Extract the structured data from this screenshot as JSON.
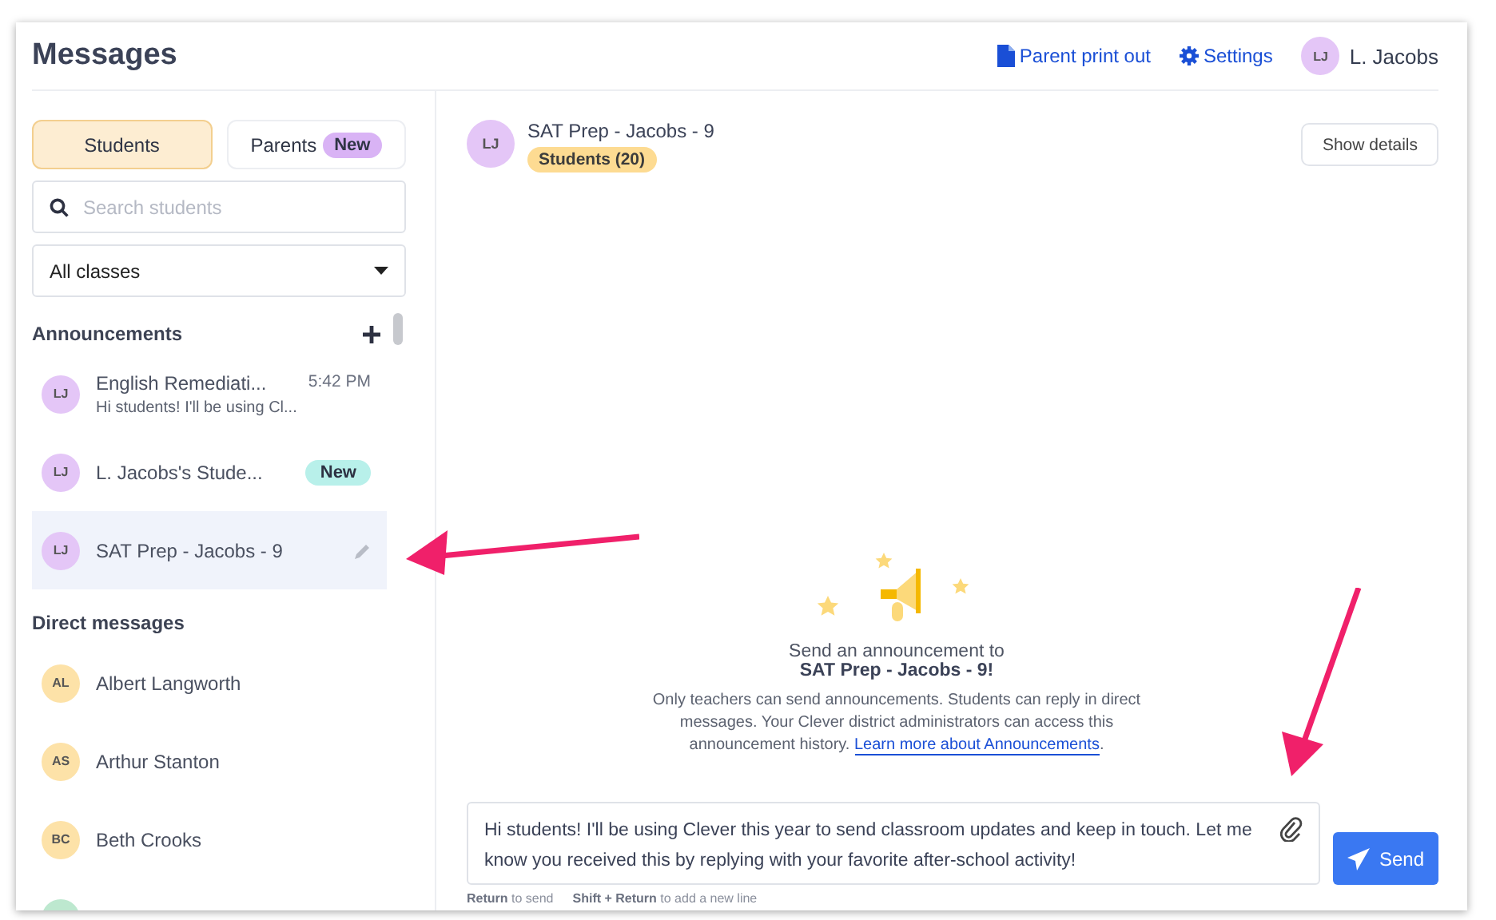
{
  "header": {
    "title": "Messages",
    "links": [
      {
        "label": "Parent print out",
        "kind": "file"
      },
      {
        "label": "Settings",
        "kind": "gear"
      }
    ],
    "user": {
      "initials": "LJ",
      "name": "L. Jacobs"
    }
  },
  "sidebar": {
    "tabs": [
      {
        "label": "Students",
        "selected": true
      },
      {
        "label": "Parents",
        "selected": false,
        "badge": "New"
      }
    ],
    "search": {
      "placeholder": "Search students"
    },
    "class_filter": {
      "value": "All classes"
    },
    "announcements": {
      "title": "Announcements",
      "items": [
        {
          "initials": "LJ",
          "color": "#e4c6f7",
          "name": "English Remediati...",
          "time": "5:42 PM",
          "preview": "Hi students! I'll be using Cl...",
          "selected": false
        },
        {
          "initials": "LJ",
          "color": "#e4c6f7",
          "name": "L. Jacobs's Stude...",
          "badge": "New",
          "selected": false
        },
        {
          "initials": "LJ",
          "color": "#e4c6f7",
          "name": "SAT Prep - Jacobs - 9",
          "selected": true
        }
      ]
    },
    "direct_messages": {
      "title": "Direct messages",
      "items": [
        {
          "initials": "AL",
          "color": "#fde2a8",
          "name": "Albert Langworth"
        },
        {
          "initials": "AS",
          "color": "#fde2a8",
          "name": "Arthur Stanton"
        },
        {
          "initials": "BC",
          "color": "#fde2a8",
          "name": "Beth Crooks"
        }
      ]
    }
  },
  "conversation": {
    "initials": "LJ",
    "title": "SAT Prep - Jacobs - 9",
    "audience": "Students (20)",
    "details_button": "Show details",
    "empty_state": {
      "line1": "Send an announcement to",
      "line2": "SAT Prep - Jacobs - 9!",
      "body": "Only teachers can send announcements. Students can reply in direct messages. Your Clever district administrators can access this announcement history.",
      "link": "Learn more about Announcements",
      "after_link": "."
    },
    "composer": {
      "value": "Hi students! I'll be using Clever this year to send classroom updates and keep in touch. Let me know you received this by replying with your favorite after-school activity!",
      "send": "Send",
      "hints": [
        {
          "key": "Return",
          "text": "to send"
        },
        {
          "key": "Shift + Return",
          "text": "to add a new line"
        }
      ]
    }
  }
}
